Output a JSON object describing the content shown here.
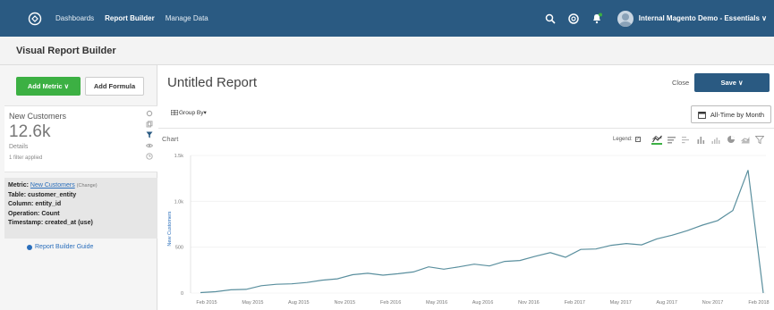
{
  "nav": {
    "links": [
      "Dashboards",
      "Report Builder",
      "Manage Data"
    ],
    "active": "Report Builder",
    "account": "Internal Magento Demo - Essentials ∨"
  },
  "subheader": {
    "title": "Visual Report Builder"
  },
  "leftpanel": {
    "add_metric": "Add Metric ∨",
    "add_formula": "Add Formula",
    "metric": {
      "name": "New Customers",
      "value": "12.6k",
      "details": "Details",
      "filter": "1 filter applied"
    },
    "info": {
      "metric_label": "Metric:",
      "metric_value": "New Customers",
      "change": "(Change)",
      "table": "Table: customer_entity",
      "column": "Column: entity_id",
      "operation": "Operation: Count",
      "timestamp": "Timestamp: created_at (use)"
    },
    "guide": "Report Builder Guide"
  },
  "main": {
    "title": "Untitled Report",
    "close": "Close",
    "save": "Save ∨",
    "group_by": "Group By▾",
    "time_button": "All-Time by Month",
    "chart_label": "Chart",
    "legend_label": "Legend:",
    "legend_check": "✓"
  },
  "colors": {
    "nav": "#2a5a82",
    "accent": "#3cb043",
    "line": "#5a8f9e"
  },
  "chart_data": {
    "type": "line",
    "ylabel": "New Customers",
    "ylim": [
      0,
      1500
    ],
    "yticks": [
      0,
      500,
      1000,
      1500
    ],
    "ytick_labels": [
      "0",
      "500",
      "1.0k",
      "1.5k"
    ],
    "xtick_labels": [
      "Feb 2015",
      "May 2015",
      "Aug 2015",
      "Nov 2015",
      "Feb 2016",
      "May 2016",
      "Aug 2016",
      "Nov 2016",
      "Feb 2017",
      "May 2017",
      "Aug 2017",
      "Nov 2017",
      "Feb 2018"
    ],
    "series": [
      {
        "values": [
          5,
          15,
          35,
          40,
          80,
          95,
          100,
          115,
          140,
          155,
          200,
          215,
          195,
          210,
          230,
          285,
          260,
          285,
          315,
          295,
          345,
          355,
          400,
          440,
          390,
          475,
          480,
          520,
          540,
          525,
          590,
          630,
          680,
          740,
          790,
          900,
          1340,
          0
        ]
      }
    ]
  }
}
